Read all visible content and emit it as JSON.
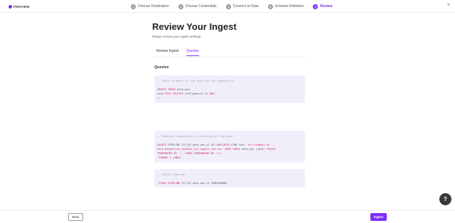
{
  "brand": {
    "logo_text": "PREVIEW",
    "accent_color": "#7b2ff7"
  },
  "wizard": {
    "steps": [
      {
        "label": "Choose Destination",
        "state": "done",
        "icon": "check-icon"
      },
      {
        "label": "Choose Credentials",
        "state": "done",
        "icon": "check-icon"
      },
      {
        "label": "Connect to Data",
        "state": "done",
        "icon": "check-icon"
      },
      {
        "label": "Schema Definition",
        "state": "done",
        "icon": "check-icon"
      },
      {
        "label": "Review",
        "state": "active",
        "number": "5"
      }
    ]
  },
  "page": {
    "title": "Review Your Ingest",
    "subtitle": "Please review your Ingest settings."
  },
  "tabs": [
    {
      "label": "Review Ingest",
      "active": false
    },
    {
      "label": "Queries",
      "active": true
    }
  ],
  "queries": {
    "section_title": "Queries",
    "block1": {
      "comment": "-- Table to where all the data will be ingested to",
      "line1_kw": "CREATE TABLE",
      "line1_rest": " data_aws(",
      "line2_name": "col0 ",
      "line2_kw": "TEXT COLLATE",
      "line2_rest": " utf8_general_ci  ",
      "line2_null": "NULL",
      "line3": ");"
    },
    "block2": {
      "comment": "-- Pipeline responsible of ingesting all the data",
      "line1_kw1": "CREATE",
      "line1_t1": " PIPELINE S3_CSV_data_aws_ui ",
      "line1_kw2": "AS LOAD DATA",
      "line1_t2": " LINK test ",
      "line1_str": "'s3://ingest-ui-",
      "line2_str": "test-bucket/csv_weather_rec_square_sim.csv'",
      "line2_kw": " INTO TABLE",
      "line2_t": " data_aws (col0) ",
      "line2_kw2": "FIELDS",
      "line3_kw": "TERMINATED BY",
      "line3_str": " ','",
      "line3_kw2": " LINES TERMINATED BY",
      "line3_str2": " '\\n'",
      "line4_kw": "IGNORE",
      "line4_t": " 1 ",
      "line4_kw2": "LINES",
      "line4_end": ";"
    },
    "block3": {
      "comment": "-- Starts Pipeline",
      "line1_kw": "START PIPELINE",
      "line1_rest": " S3_CSV_data_aws_ui FOREGROUND;"
    }
  },
  "help": {
    "label": "?"
  },
  "footer": {
    "back_label": "Back",
    "ingest_label": "Ingest"
  }
}
